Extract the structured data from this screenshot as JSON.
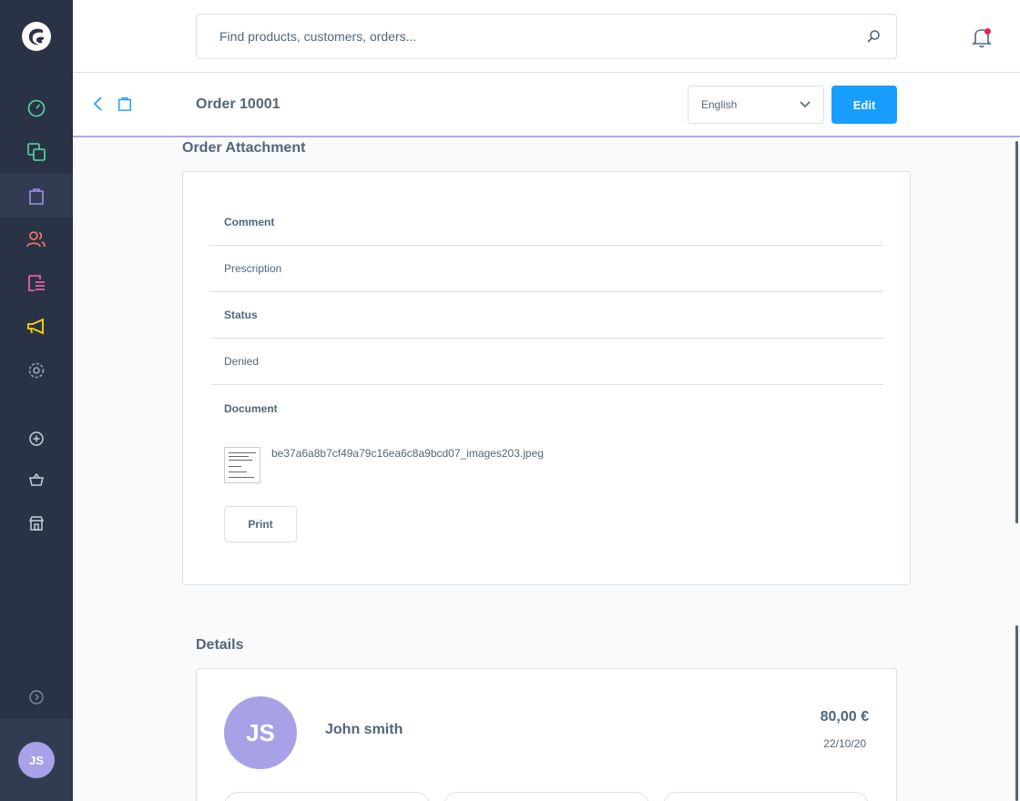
{
  "search": {
    "placeholder": "Find products, customers, orders..."
  },
  "smartbar": {
    "title": "Order 10001",
    "language": "English",
    "edit_label": "Edit"
  },
  "attachment": {
    "section_title": "Order Attachment",
    "comment_label": "Comment",
    "comment_value": "Prescription",
    "status_label": "Status",
    "status_value": "Denied",
    "document_label": "Document",
    "document_filename": "be37a6a8b7cf49a79c16ea6c8a9bcd07_images203.jpeg",
    "print_label": "Print"
  },
  "details": {
    "section_title": "Details",
    "customer_initials": "JS",
    "customer_name": "John smith",
    "amount": "80,00 €",
    "date": "22/10/20"
  },
  "user": {
    "initials": "JS"
  },
  "colors": {
    "sidebar": "#2a3345",
    "accent": "#189eff",
    "avatar": "#a7a1e8",
    "dashboard": "#57d9a3",
    "catalogues": "#57d9a3",
    "orders": "#a092f0",
    "customers": "#ff7b65",
    "content": "#ff68b4",
    "marketing": "#ffd700",
    "settings": "#9aa8b5"
  }
}
